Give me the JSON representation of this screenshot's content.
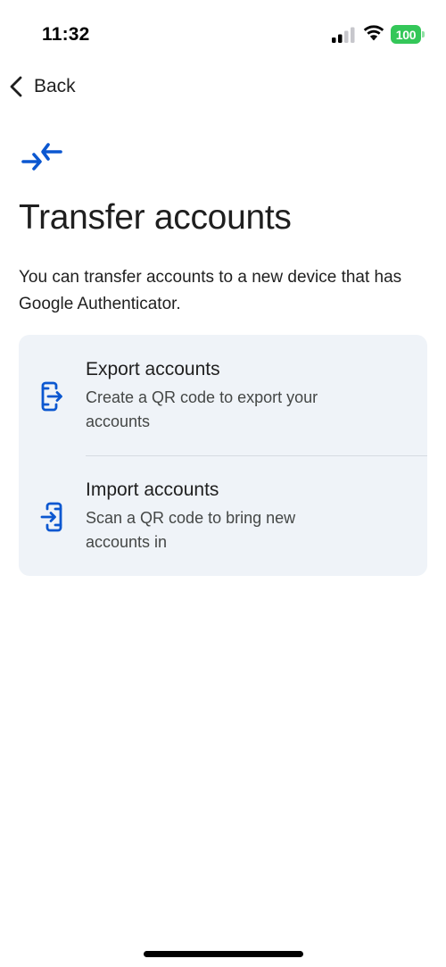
{
  "status_bar": {
    "time": "11:32",
    "battery_level": "100",
    "battery_color": "#34c759",
    "icons": [
      "signal-icon",
      "wifi-icon",
      "battery-icon"
    ]
  },
  "nav": {
    "back_label": "Back",
    "back_icon": "chevron-left-icon"
  },
  "header": {
    "icon": "transfer-arrows-icon",
    "title": "Transfer accounts",
    "description": "You can transfer accounts to a new device that has Google Authenticator."
  },
  "options": [
    {
      "icon": "export-device-icon",
      "title": "Export accounts",
      "description": "Create a QR code to export your accounts"
    },
    {
      "icon": "import-device-icon",
      "title": "Import accounts",
      "description": "Scan a QR code to bring new accounts in"
    }
  ],
  "colors": {
    "accent": "#0b57d0",
    "card_background": "#eff3f8",
    "text_primary": "#1f1f1f",
    "text_secondary": "#444746"
  }
}
